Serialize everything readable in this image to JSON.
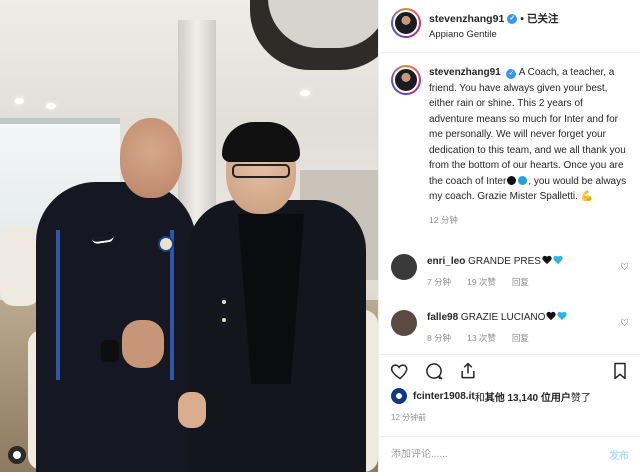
{
  "header": {
    "username": "stevenzhang91",
    "separator": "•",
    "follow_status": "已关注",
    "location": "Appiano Gentile"
  },
  "caption": {
    "username": "stevenzhang91",
    "text_part1": "A Coach, a teacher, a friend. You have always given your best, either rain or shine. This 2 years of adventure means so much for Inter and for me personally. We will never forget your dedication to this team, and we all thank you from the bottom of our hearts. Once you are the coach of Inter",
    "text_part2": ", you would be always my coach. Grazie Mister Spalletti.",
    "emoji_end": "💪",
    "time": "12 分钟"
  },
  "comments": [
    {
      "username": "enri_leo",
      "text": "GRANDE PRES",
      "time": "7 分钟",
      "likes": "19 次赞",
      "reply": "回复",
      "avatar_color": "#3a3a3a"
    },
    {
      "username": "falle98",
      "text": "GRAZIE LUCIANO",
      "time": "8 分钟",
      "likes": "13 次赞",
      "reply": "回复",
      "avatar_color": "#5b4a3f"
    }
  ],
  "likes_bar": {
    "liked_by": "fcinter1908.it",
    "middle": " 和 ",
    "others": "其他 13,140 位用户",
    "suffix": " 赞了"
  },
  "post_time": "12 分钟前",
  "add_comment": {
    "placeholder": "添加评论......",
    "post_label": "发布"
  },
  "colors": {
    "verified": "#3897f0",
    "inter_blue": "#1fa3e0",
    "muted": "#8e8e8e",
    "post_button": "#b2dffc"
  }
}
